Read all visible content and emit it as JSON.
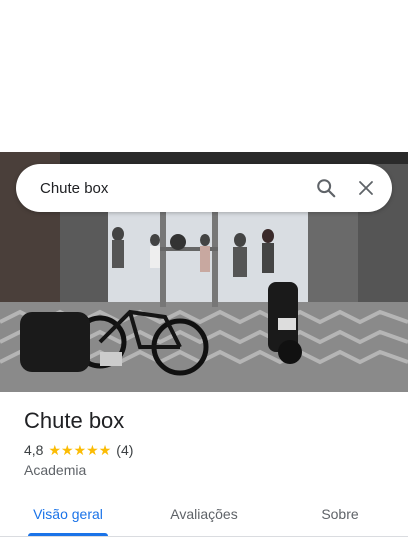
{
  "search": {
    "query": "Chute box"
  },
  "place": {
    "name": "Chute box",
    "rating": "4,8",
    "review_count": "(4)",
    "stars": 5,
    "category": "Academia"
  },
  "tabs": [
    {
      "label": "Visão geral",
      "active": true
    },
    {
      "label": "Avaliações",
      "active": false
    },
    {
      "label": "Sobre",
      "active": false
    }
  ],
  "colors": {
    "accent": "#1a73e8",
    "star": "#fbbc04"
  },
  "icons": {
    "search": "search-icon",
    "close": "close-icon"
  }
}
